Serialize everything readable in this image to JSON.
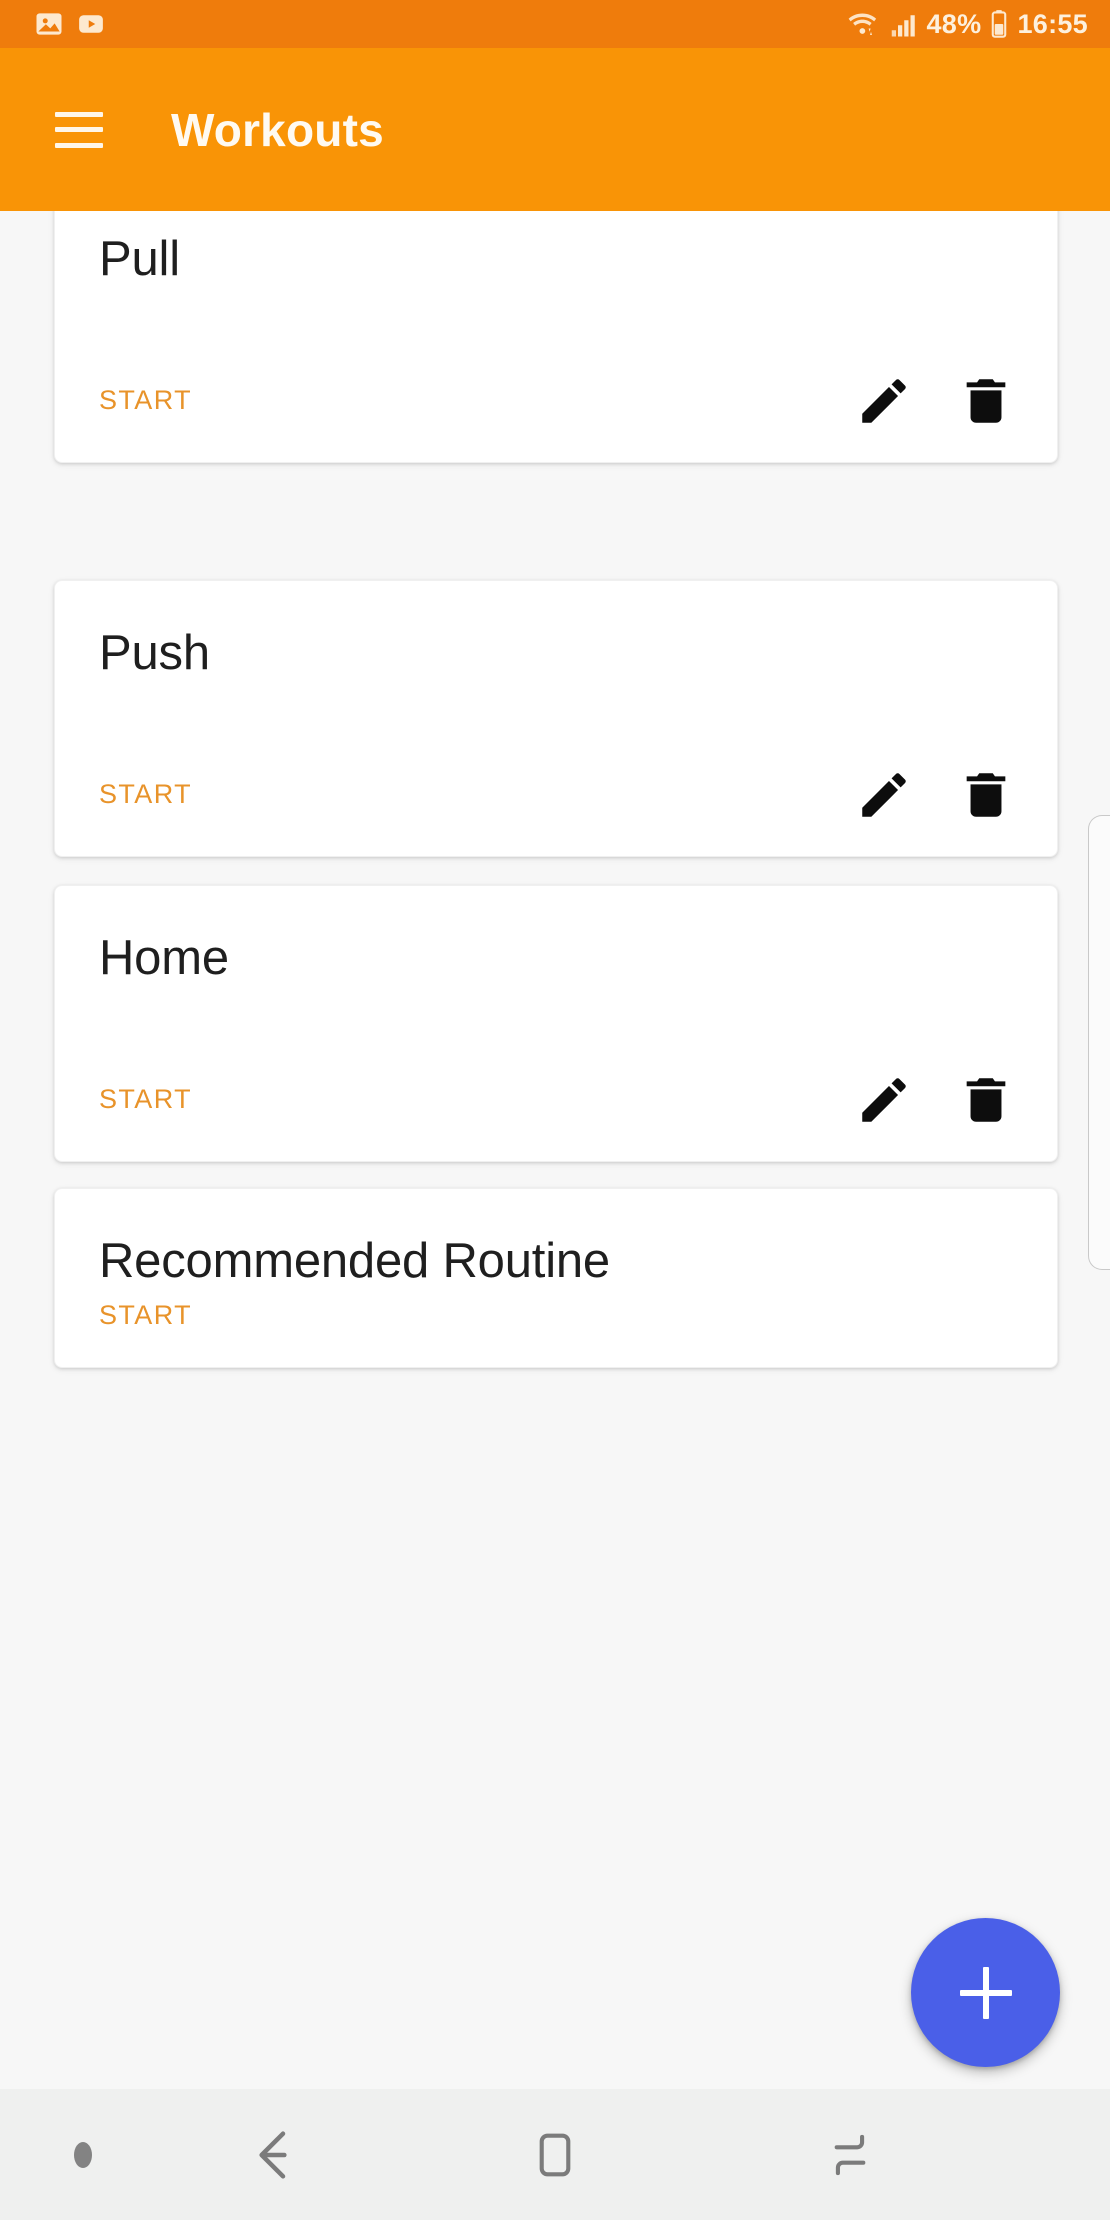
{
  "status_bar": {
    "left_icons": [
      "gallery-icon",
      "youtube-icon"
    ],
    "wifi_icon": "wifi-icon",
    "signal_icon": "signal-bars-icon",
    "battery_percent": "48%",
    "battery_icon": "battery-icon",
    "time": "16:55",
    "background_color": "#ef7c0c"
  },
  "app_bar": {
    "menu_icon": "hamburger-menu-icon",
    "title": "Workouts",
    "background_color": "#f99406",
    "text_color": "#fffaf1"
  },
  "content": {
    "background_color": "#f7f7f7",
    "start_label": "START",
    "start_color": "#e8932a",
    "edit_icon": "pencil-icon",
    "delete_icon": "trash-icon",
    "cards": [
      {
        "title": "Pull",
        "start": "START",
        "has_edit": true,
        "has_delete": true
      },
      {
        "title": "Push",
        "start": "START",
        "has_edit": true,
        "has_delete": true
      },
      {
        "title": "Home",
        "start": "START",
        "has_edit": true,
        "has_delete": true
      },
      {
        "title": "Recommended Routine",
        "start": "START",
        "has_edit": false,
        "has_delete": false
      }
    ]
  },
  "fab": {
    "icon": "plus-icon",
    "label": "+",
    "color": "#4a5fe8"
  },
  "edge_panel": {
    "handle": "edge-panel-handle"
  },
  "nav_bar": {
    "background_color": "#eff0ef",
    "items": [
      {
        "name": "nav-dot-indicator"
      },
      {
        "name": "back-icon"
      },
      {
        "name": "home-icon"
      },
      {
        "name": "recents-icon"
      }
    ]
  }
}
